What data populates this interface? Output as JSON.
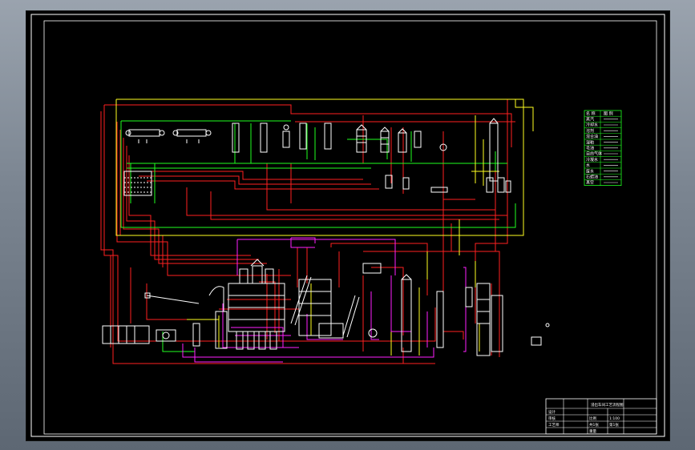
{
  "drawing": {
    "colors": {
      "background": "#000000",
      "frame": "#ffffff",
      "steam": "#ff0000",
      "water": "#00ff00",
      "oil": "#ffff00",
      "solvent": "#ff00ff",
      "equipment": "#ffffff"
    }
  },
  "legend": {
    "rows": [
      {
        "label": "名 称",
        "value": "图 例"
      },
      {
        "label": "蒸汽",
        "value": ""
      },
      {
        "label": "冷却水",
        "value": ""
      },
      {
        "label": "溶剂",
        "value": ""
      },
      {
        "label": "混合油",
        "value": ""
      },
      {
        "label": "湿粕",
        "value": ""
      },
      {
        "label": "毛油",
        "value": ""
      },
      {
        "label": "自由气体",
        "value": ""
      },
      {
        "label": "冷凝水",
        "value": ""
      },
      {
        "label": "水",
        "value": ""
      },
      {
        "label": "废水",
        "value": ""
      },
      {
        "label": "石蜡油",
        "value": ""
      },
      {
        "label": "真空",
        "value": ""
      }
    ]
  },
  "title_block": {
    "drawing_name": "浸出车间工艺流程图",
    "cells": [
      "设计",
      "审核",
      "工艺师",
      "比例",
      "1:100",
      "共1张",
      "第1张",
      "重量"
    ]
  }
}
